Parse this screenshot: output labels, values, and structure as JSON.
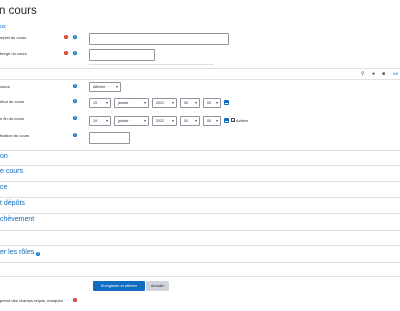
{
  "header": {
    "title": "n cours",
    "subtitle": "ux"
  },
  "fields": {
    "fullname_label": "mplet du cours",
    "shortname_label": "brégé du cours",
    "visibility_label": "cours",
    "visibility_value": "Afficher",
    "startdate_label": "ébut du cours",
    "enddate_label": "e fin du cours",
    "idnumber_label": "fication du cours"
  },
  "start_date": {
    "day": "19",
    "month": "janvier",
    "year": "2021",
    "hour": "00",
    "minute": "00"
  },
  "end_date": {
    "day": "19",
    "month": "janvier",
    "year": "2022",
    "hour": "00",
    "minute": "00",
    "enable_label": "Activer",
    "enabled": true
  },
  "toolbar": {
    "more_label": "Aff"
  },
  "sections": [
    {
      "label": "on"
    },
    {
      "label": "e cours"
    },
    {
      "label": "ce"
    },
    {
      "label": "t dépôts"
    },
    {
      "label": "chèvement"
    },
    {
      "label": "er les rôles"
    }
  ],
  "actions": {
    "save_label": "Enregistrer et afficher",
    "cancel_label": "Annuler"
  },
  "footer": {
    "required_note": "prend des champs requis, marqués"
  },
  "colors": {
    "accent": "#0f6cbf",
    "required": "#ca3120"
  }
}
